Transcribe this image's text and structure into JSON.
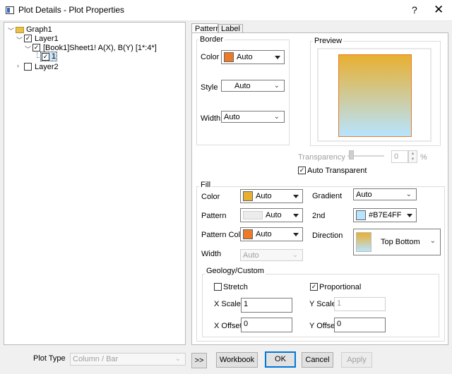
{
  "window": {
    "title": "Plot Details - Plot Properties",
    "help": "?",
    "close": "✕"
  },
  "tree": {
    "graph": "Graph1",
    "layer1": "Layer1",
    "plot": "[Book1]Sheet1! A(X), B(Y) [1*:4*]",
    "point": "1",
    "layer2": "Layer2"
  },
  "tabs": {
    "pattern": "Pattern",
    "label": "Label"
  },
  "border": {
    "title": "Border",
    "color_label": "Color",
    "color_value": "Auto",
    "color_hex": "#ec7a28",
    "style_label": "Style",
    "style_value": "Auto",
    "width_label": "Width",
    "width_value": "Auto"
  },
  "preview": {
    "title": "Preview"
  },
  "transparency": {
    "label": "Transparency",
    "value": "0",
    "unit": "%",
    "auto_label": "Auto Transparent",
    "auto_checked": "✓"
  },
  "fill": {
    "title": "Fill",
    "color_label": "Color",
    "color_value": "Auto",
    "color_hex": "#e8b030",
    "pattern_label": "Pattern",
    "pattern_value": "Auto",
    "pattern_color_label": "Pattern Color",
    "pattern_color_value": "Auto",
    "pattern_color_hex": "#ec7a28",
    "width_label": "Width",
    "width_value": "Auto",
    "gradient_label": "Gradient",
    "gradient_value": "Auto",
    "second_label": "2nd",
    "second_value": "#B7E4FF",
    "second_hex": "#B7E4FF",
    "direction_label": "Direction",
    "direction_value": "Top Bottom"
  },
  "geology": {
    "title": "Geology/Custom",
    "stretch_label": "Stretch",
    "stretch_checked": "",
    "proportional_label": "Proportional",
    "proportional_checked": "✓",
    "xscale_label": "X Scale",
    "xscale_value": "1",
    "yscale_label": "Y Scale",
    "yscale_value": "1",
    "xoffset_label": "X Offset",
    "xoffset_value": "0",
    "yoffset_label": "Y Offset",
    "yoffset_value": "0"
  },
  "bottom": {
    "plot_type_label": "Plot Type",
    "plot_type_value": "Column / Bar",
    "more": ">>",
    "workbook": "Workbook",
    "ok": "OK",
    "cancel": "Cancel",
    "apply": "Apply"
  }
}
